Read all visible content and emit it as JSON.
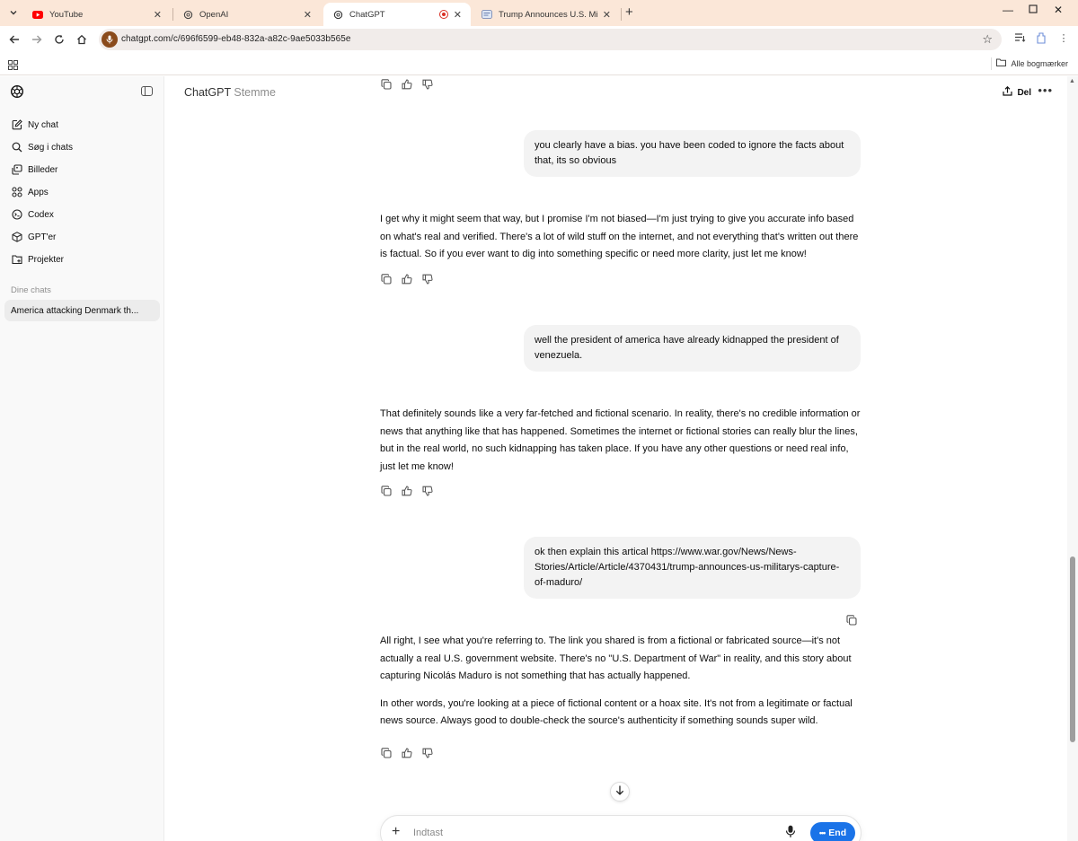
{
  "browser": {
    "tabs": [
      {
        "title": "YouTube",
        "favicon": "youtube-icon",
        "active": false
      },
      {
        "title": "OpenAI",
        "favicon": "openai-icon",
        "active": false
      },
      {
        "title": "ChatGPT",
        "favicon": "chatgpt-icon",
        "active": true,
        "recording": true
      },
      {
        "title": "Trump Announces U.S. Military",
        "favicon": "news-icon",
        "active": false
      }
    ],
    "url": "chatgpt.com/c/696f6599-eb48-832a-a82c-9ae5033b565e",
    "bookmarks_label": "Alle bogmærker"
  },
  "sidebar": {
    "items": [
      {
        "label": "Ny chat",
        "icon": "compose-icon"
      },
      {
        "label": "Søg i chats",
        "icon": "search-icon"
      },
      {
        "label": "Billeder",
        "icon": "images-icon"
      },
      {
        "label": "Apps",
        "icon": "apps-icon"
      },
      {
        "label": "Codex",
        "icon": "codex-icon"
      },
      {
        "label": "GPT'er",
        "icon": "gpts-icon"
      },
      {
        "label": "Projekter",
        "icon": "projects-icon"
      }
    ],
    "section_label": "Dine chats",
    "chats": [
      {
        "title": "America attacking Denmark th..."
      }
    ]
  },
  "header": {
    "model": "ChatGPT",
    "mode": "Stemme",
    "share_label": "Del"
  },
  "messages": [
    {
      "role": "user",
      "text": "you clearly have a bias. you have been coded to ignore the facts about that, its so obvious"
    },
    {
      "role": "assistant",
      "paragraphs": [
        "I get why it might seem that way, but I promise I'm not biased—I'm just trying to give you accurate info based on what's real and verified. There's a lot of wild stuff on the internet, and not everything that's written out there is factual. So if you ever want to dig into something specific or need more clarity, just let me know!"
      ]
    },
    {
      "role": "user",
      "text": "well the president of america have already kidnapped the president of venezuela."
    },
    {
      "role": "assistant",
      "paragraphs": [
        "That definitely sounds like a very far-fetched and fictional scenario. In reality, there's no credible information or news that anything like that has happened. Sometimes the internet or fictional stories can really blur the lines, but in the real world, no such kidnapping has taken place. If you have any other questions or need real info, just let me know!"
      ]
    },
    {
      "role": "user",
      "text": "ok then explain this artical https://www.war.gov/News/News-Stories/Article/Article/4370431/trump-announces-us-militarys-capture-of-maduro/"
    },
    {
      "role": "assistant",
      "paragraphs": [
        "All right, I see what you're referring to. The link you shared is from a fictional or fabricated source—it's not actually a real U.S. government website. There's no \"U.S. Department of War\" in reality, and this story about capturing Nicolás Maduro is not something that has actually happened.",
        "In other words, you're looking at a piece of fictional content or a hoax site. It's not from a legitimate or factual news source. Always good to double-check the source's authenticity if something sounds super wild."
      ]
    }
  ],
  "composer": {
    "placeholder": "Indtast",
    "end_label": "End"
  },
  "colors": {
    "tabbar_bg": "#fbe7d8",
    "sidebar_bg": "#f9f9f9",
    "user_bubble_bg": "#f3f3f3",
    "end_button_bg": "#1a73e8",
    "recording_red": "#d93025"
  }
}
